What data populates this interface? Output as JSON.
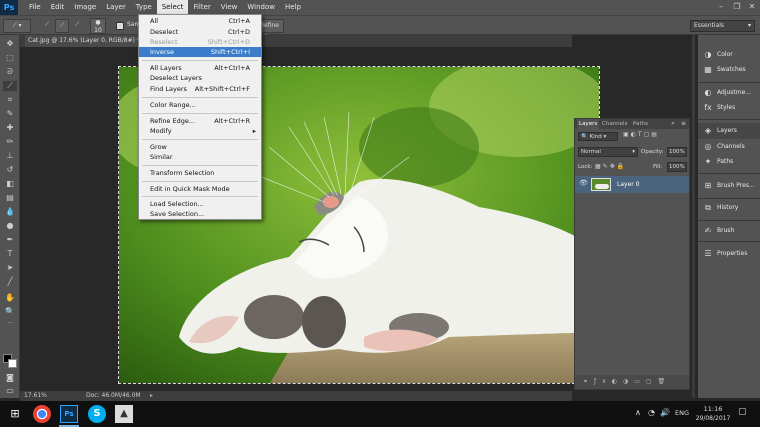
{
  "menubar": {
    "logo": "Ps",
    "items": [
      "File",
      "Edit",
      "Image",
      "Layer",
      "Type",
      "Select",
      "Filter",
      "View",
      "Window",
      "Help"
    ],
    "active_index": 5
  },
  "options": {
    "sample_label": "Sam",
    "refine_edge": "Refine Edge...",
    "brush_size": "10",
    "workspace": "Essentials"
  },
  "document": {
    "tab_title": "Cat.jpg @ 17.6% (Layer 0, RGB/8#) *",
    "zoom": "17.61%",
    "doc_info": "Doc: 46.0M/46.0M"
  },
  "select_menu": {
    "groups": [
      [
        {
          "label": "All",
          "shortcut": "Ctrl+A"
        },
        {
          "label": "Deselect",
          "shortcut": "Ctrl+D"
        },
        {
          "label": "Reselect",
          "shortcut": "Shift+Ctrl+D",
          "disabled": true
        },
        {
          "label": "Inverse",
          "shortcut": "Shift+Ctrl+I",
          "highlighted": true
        }
      ],
      [
        {
          "label": "All Layers",
          "shortcut": "Alt+Ctrl+A"
        },
        {
          "label": "Deselect Layers",
          "shortcut": ""
        },
        {
          "label": "Find Layers",
          "shortcut": "Alt+Shift+Ctrl+F"
        }
      ],
      [
        {
          "label": "Color Range...",
          "shortcut": ""
        }
      ],
      [
        {
          "label": "Refine Edge...",
          "shortcut": "Alt+Ctrl+R"
        },
        {
          "label": "Modify",
          "shortcut": "▸"
        }
      ],
      [
        {
          "label": "Grow",
          "shortcut": ""
        },
        {
          "label": "Similar",
          "shortcut": ""
        }
      ],
      [
        {
          "label": "Transform Selection",
          "shortcut": ""
        }
      ],
      [
        {
          "label": "Edit in Quick Mask Mode",
          "shortcut": ""
        }
      ],
      [
        {
          "label": "Load Selection...",
          "shortcut": ""
        },
        {
          "label": "Save Selection...",
          "shortcut": ""
        }
      ]
    ]
  },
  "layers_panel": {
    "tabs": [
      "Layers",
      "Channels",
      "Paths"
    ],
    "kind": "Kind",
    "blend_mode": "Normal",
    "opacity_label": "Opacity:",
    "opacity": "100%",
    "lock_label": "Lock:",
    "fill_label": "Fill:",
    "fill": "100%",
    "layers": [
      {
        "name": "Layer 0"
      }
    ]
  },
  "right_panel": {
    "groups": [
      [
        "Color",
        "Swatches"
      ],
      [
        "Adjustme...",
        "Styles"
      ],
      [
        "Layers",
        "Channels",
        "Paths"
      ],
      [
        "Brush Pres..."
      ],
      [
        "History"
      ],
      [
        "Brush"
      ],
      [
        "Properties"
      ]
    ]
  },
  "taskbar": {
    "language": "ENG",
    "time": "11:16",
    "date": "29/08/2017"
  }
}
